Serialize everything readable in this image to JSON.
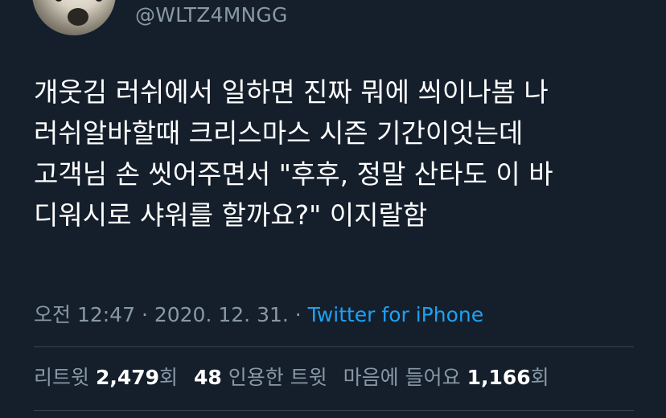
{
  "user": {
    "handle": "@WLTZ4MNGG"
  },
  "tweet": {
    "lines": [
      "개웃김 러쉬에서 일하면 진짜 뭐에 씌이나봄 나",
      "러쉬알바할때 크리스마스 시즌 기간이엇는데",
      "고객님 손 씻어주면서 \"후후, 정말 산타도 이 바",
      "디워시로 샤워를 할까요?\" 이지랄함"
    ]
  },
  "meta": {
    "time": "오전 12:47",
    "separator1": " · ",
    "date": "2020. 12. 31.",
    "separator2": " · ",
    "source": "Twitter for iPhone"
  },
  "stats": {
    "retweets_label": "리트윗",
    "retweets_count": "2,479",
    "retweets_suffix": "회",
    "quotes_count": "48",
    "quotes_label": "인용한 트윗",
    "likes_label": "마음에 들어요",
    "likes_count": "1,166",
    "likes_suffix": "회"
  }
}
